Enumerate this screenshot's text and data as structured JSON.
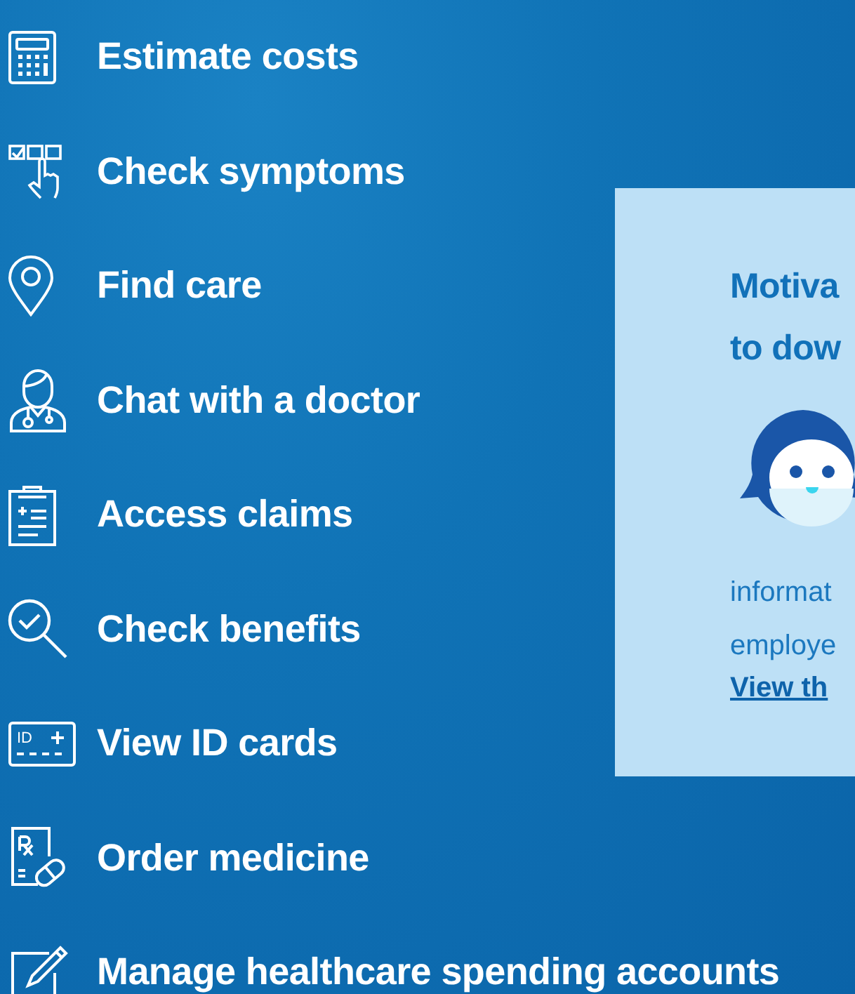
{
  "actions": [
    {
      "label": "Estimate costs"
    },
    {
      "label": "Check symptoms"
    },
    {
      "label": "Find care"
    },
    {
      "label": "Chat with a doctor"
    },
    {
      "label": "Access claims"
    },
    {
      "label": "Check benefits"
    },
    {
      "label": "View ID cards",
      "icon_text": "ID"
    },
    {
      "label": "Order medicine"
    },
    {
      "label": "Manage healthcare spending accounts"
    }
  ],
  "promo_card": {
    "heading_lines": [
      "Motiva",
      "to dow"
    ],
    "body_lines": [
      "informat",
      "employe"
    ],
    "link": "View th"
  }
}
